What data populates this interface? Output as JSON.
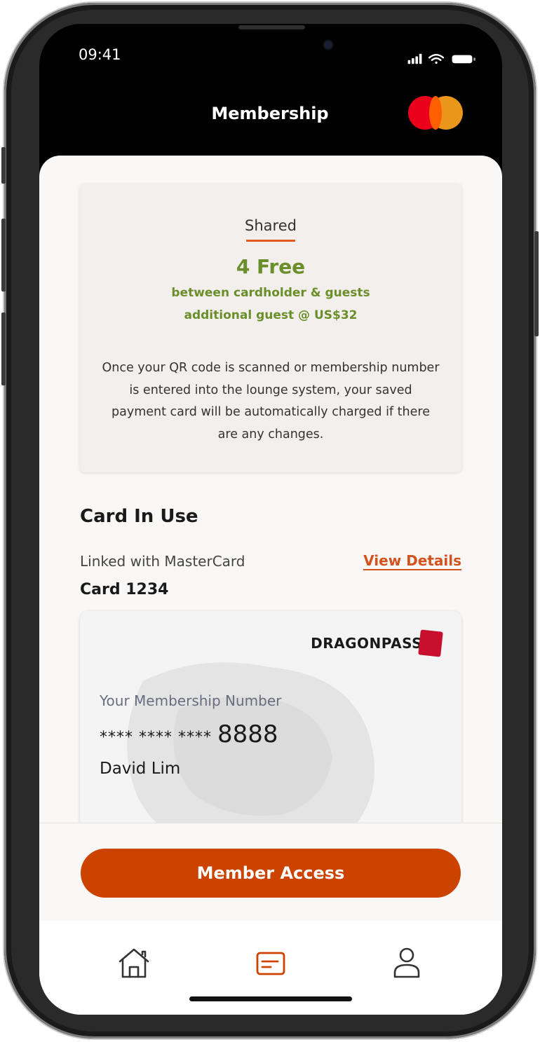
{
  "status_bar": {
    "time": "09:41"
  },
  "header": {
    "title": "Membership",
    "logo_icon": "mastercard-logo"
  },
  "benefit": {
    "tab_label": "Shared",
    "free_count": "4 Free",
    "note_line1": "between cardholder & guests",
    "note_line2": "additional guest @ US$32",
    "description": "Once your QR code is scanned or membership number is entered into the lounge system, your saved payment card will be automatically charged if there are any changes."
  },
  "card_section": {
    "title": "Card In Use",
    "linked_text": "Linked with MasterCard",
    "view_details": "View Details",
    "card_label": "Card 1234"
  },
  "member_card": {
    "brand": "DRAGONPASS",
    "membership_label": "Your Membership Number",
    "number_masked": "**** **** ****",
    "number_last": "8888",
    "holder_name": "David Lim"
  },
  "cta": {
    "label": "Member Access"
  },
  "tab_bar": {
    "items": [
      {
        "icon": "home-icon",
        "active": false
      },
      {
        "icon": "card-icon",
        "active": true
      },
      {
        "icon": "profile-icon",
        "active": false
      }
    ]
  },
  "colors": {
    "accent": "#cc4300",
    "link": "#d4521b",
    "benefit_green": "#6a8f2a",
    "tab_inactive": "#333333"
  }
}
